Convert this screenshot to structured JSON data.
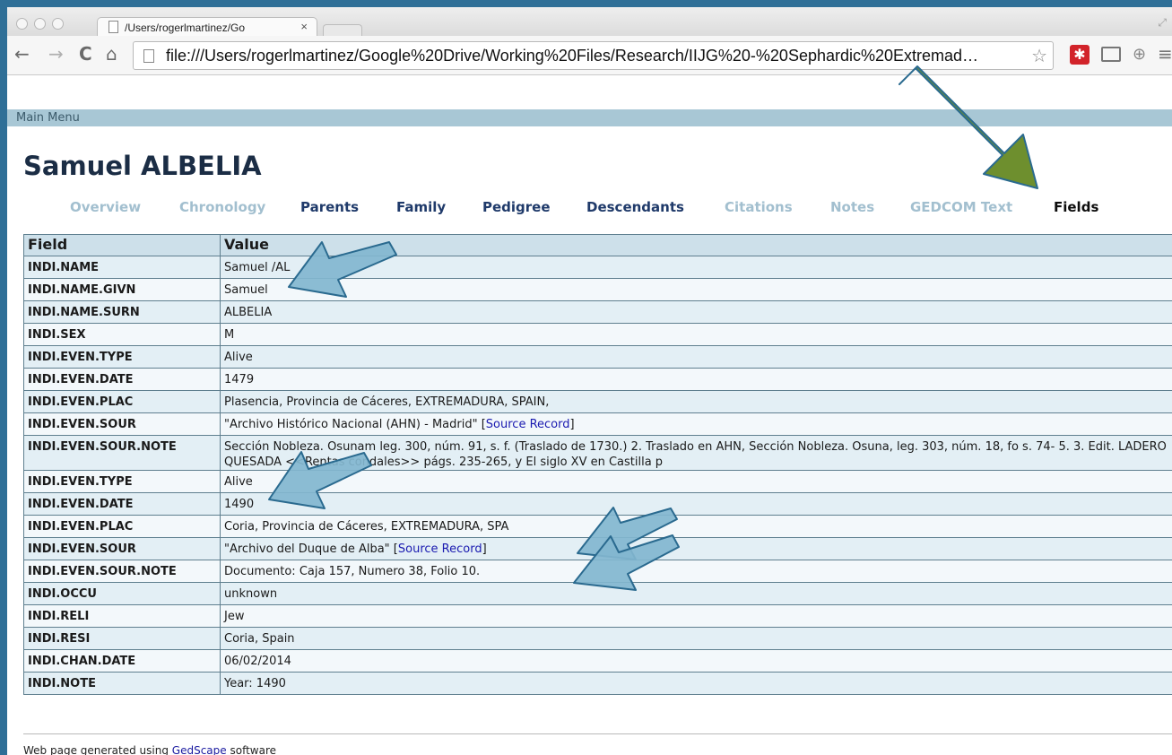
{
  "browser": {
    "tab_title": "/Users/rogerlmartinez/Go",
    "tab_close": "×",
    "address": "file:///Users/rogerlmartinez/Google%20Drive/Working%20Files/Research/IIJG%20-%20Sephardic%20Extremad…",
    "nav": {
      "back": "←",
      "forward": "→",
      "reload": "C",
      "home": "⌂"
    },
    "icons": [
      "bookmark-star-icon",
      "extension-red-icon",
      "cast-icon",
      "pocket-icon",
      "menu-icon"
    ]
  },
  "page": {
    "main_menu": "Main Menu",
    "person_name": "Samuel ALBELIA",
    "tabs": [
      {
        "label": "Overview",
        "state": "disabled"
      },
      {
        "label": "Chronology",
        "state": "disabled"
      },
      {
        "label": "Parents",
        "state": "link"
      },
      {
        "label": "Family",
        "state": "link"
      },
      {
        "label": "Pedigree",
        "state": "link"
      },
      {
        "label": "Descendants",
        "state": "link"
      },
      {
        "label": "Citations",
        "state": "disabled"
      },
      {
        "label": "Notes",
        "state": "disabled"
      },
      {
        "label": "GEDCOM Text",
        "state": "disabled"
      },
      {
        "label": "Fields",
        "state": "current"
      }
    ],
    "table": {
      "headers": [
        "Field",
        "Value"
      ],
      "rows": [
        {
          "field": "INDI.NAME",
          "value": "Samuel /AL"
        },
        {
          "field": "INDI.NAME.GIVN",
          "value": "Samuel"
        },
        {
          "field": "INDI.NAME.SURN",
          "value": "ALBELIA"
        },
        {
          "field": "INDI.SEX",
          "value": "M"
        },
        {
          "field": "INDI.EVEN.TYPE",
          "value": "Alive"
        },
        {
          "field": "INDI.EVEN.DATE",
          "value": "1479"
        },
        {
          "field": "INDI.EVEN.PLAC",
          "value": "Plasencia, Provincia de Cáceres, EXTREMADURA, SPAIN,"
        },
        {
          "field": "INDI.EVEN.SOUR",
          "value": "\"Archivo Histórico Nacional (AHN) - Madrid\" [",
          "link": "Source Record",
          "after": "]"
        },
        {
          "field": "INDI.EVEN.SOUR.NOTE",
          "value": "Sección Nobleza. Osunam leg. 300, núm. 91, s. f. (Traslado de 1730.) 2. Traslado en AHN, Sección Nobleza. Osuna, leg. 303, núm. 18, fo  s. 74-  5. 3. Edit. LADERO QUESADA <<Rentas condales>> págs. 235-265, y El siglo XV en Castilla p"
        },
        {
          "field": "INDI.EVEN.TYPE",
          "value": "Alive"
        },
        {
          "field": "INDI.EVEN.DATE",
          "value": "1490"
        },
        {
          "field": "INDI.EVEN.PLAC",
          "value": "Coria, Provincia de Cáceres, EXTREMADURA, SPA"
        },
        {
          "field": "INDI.EVEN.SOUR",
          "value": "\"Archivo del Duque de Alba\" [",
          "link": "Source Record",
          "after": "]"
        },
        {
          "field": "INDI.EVEN.SOUR.NOTE",
          "value": "Documento: Caja 157, Numero 38, Folio 10."
        },
        {
          "field": "INDI.OCCU",
          "value": "unknown"
        },
        {
          "field": "INDI.RELI",
          "value": "Jew"
        },
        {
          "field": "INDI.RESI",
          "value": "Coria, Spain"
        },
        {
          "field": "INDI.CHAN.DATE",
          "value": "06/02/2014"
        },
        {
          "field": "INDI.NOTE",
          "value": "Year: 1490"
        }
      ]
    },
    "footer": {
      "prefix": "Web page generated using ",
      "link": "GedScape",
      "suffix": " software"
    }
  },
  "colors": {
    "frame": "#2f6f97",
    "main_menu_bar": "#a8c7d5",
    "tab_disabled": "#a2bfcf",
    "tab_link": "#1f3a6a",
    "table_header": "#cde0ea",
    "annotation_arrow_blue": "#7fb3cc",
    "annotation_arrow_green": "#6e8f2e"
  }
}
